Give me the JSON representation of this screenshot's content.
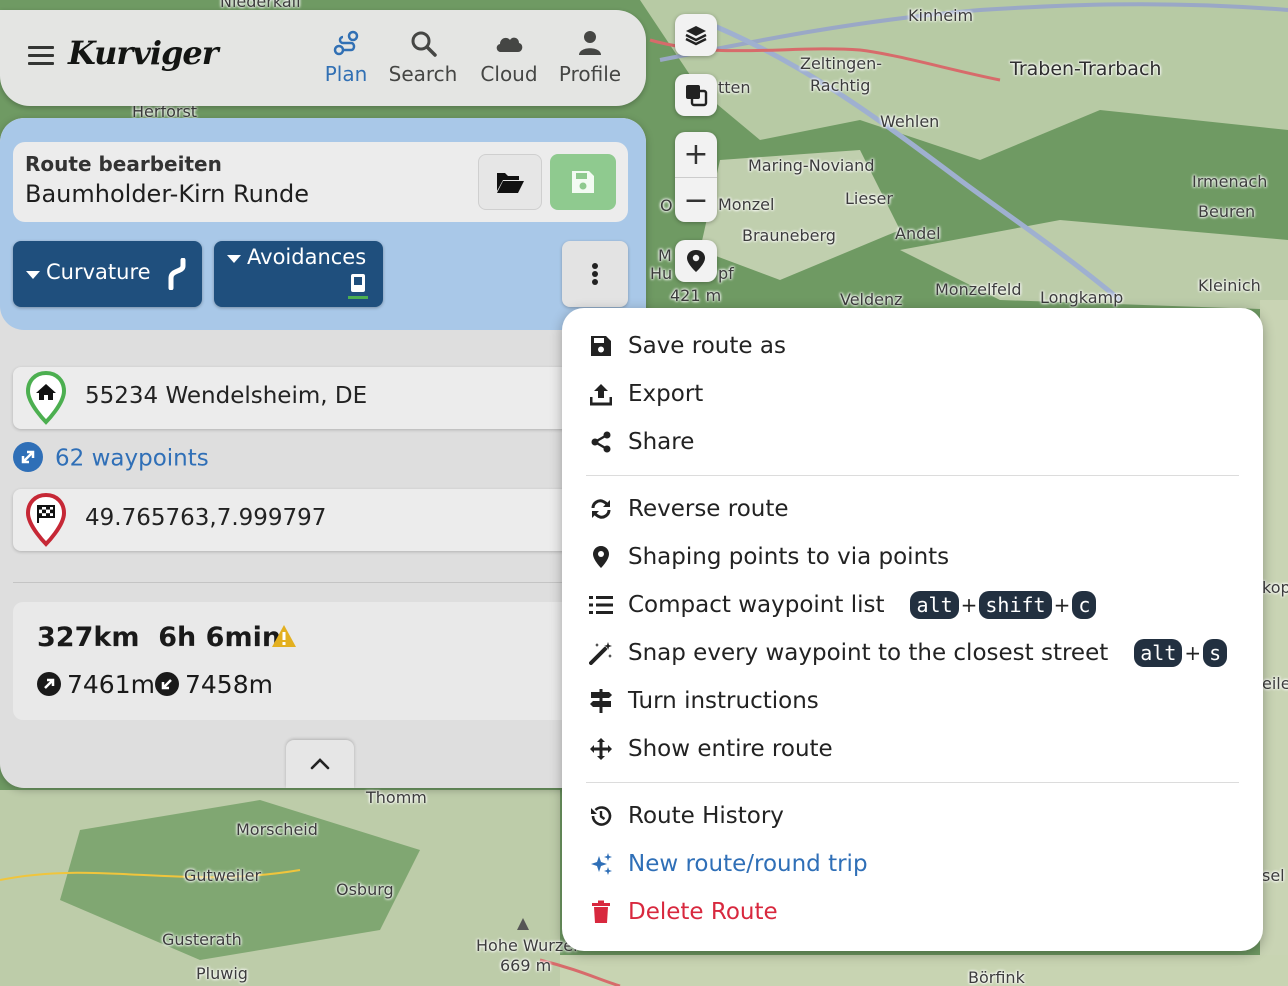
{
  "app": {
    "logo_text": "Kurviger"
  },
  "nav": {
    "items": [
      {
        "label": "Plan",
        "icon": "plan-route-icon",
        "active": true
      },
      {
        "label": "Search",
        "icon": "search-icon"
      },
      {
        "label": "Cloud",
        "icon": "cloud-icon"
      },
      {
        "label": "Profile",
        "icon": "user-icon"
      }
    ]
  },
  "map": {
    "labels": [
      "Niederkail",
      "Kinheim",
      "Zeltingen-",
      "Rachtig",
      "Traben-Trarbach",
      "Wehlen",
      "Maring-Noviand",
      "Lieser",
      "Monzel",
      "Irmenach",
      "Beuren",
      "Brauneberg",
      "Andel",
      "Kleinich",
      "Monzelfeld",
      "Longkamp",
      "Veldenz",
      "421 m",
      "Herforst",
      "Thomm",
      "Morscheid",
      "Gutweiler",
      "Osburg",
      "Gusterath",
      "Pluwig",
      "Hohe Wurzel",
      "669 m",
      "Börfink",
      "tten",
      "Hu",
      "pf",
      "M",
      "kop",
      "eile",
      "sel",
      "O"
    ]
  },
  "controls": {
    "layers": "layers-icon",
    "overlay": "overlay-icon",
    "zoom_in": "+",
    "zoom_out": "−",
    "locate": "map-marker-icon"
  },
  "panel": {
    "title": "Route bearbeiten",
    "route_name": "Baumholder-Kirn Runde",
    "curvature_label": "Curvature",
    "avoidances_label": "Avoidances",
    "start": "55234 Wendelsheim, DE",
    "waypoints_link": "62 waypoints",
    "destination": "49.765763,7.999797",
    "distance": "327km",
    "duration": "6h 6min",
    "ascent": "7461m",
    "descent": "7458m"
  },
  "menu": {
    "items": [
      {
        "label": "Save route as",
        "icon": "floppy-disk-icon"
      },
      {
        "label": "Export",
        "icon": "upload-icon"
      },
      {
        "label": "Share",
        "icon": "share-icon"
      },
      {
        "label": "Reverse route",
        "icon": "sync-icon"
      },
      {
        "label": "Shaping points to via points",
        "icon": "location-pin-icon"
      },
      {
        "label": "Compact waypoint list",
        "icon": "list-icon",
        "shortcut": [
          "alt",
          "shift",
          "c"
        ]
      },
      {
        "label": "Snap every waypoint to the closest street",
        "icon": "magic-wand-icon",
        "shortcut": [
          "alt",
          "s"
        ]
      },
      {
        "label": "Turn instructions",
        "icon": "signpost-icon"
      },
      {
        "label": "Show entire route",
        "icon": "move-arrows-icon"
      },
      {
        "label": "Route History",
        "icon": "history-icon"
      },
      {
        "label": "New route/round trip",
        "icon": "sparkles-icon",
        "color": "#2f6fb7"
      },
      {
        "label": "Delete Route",
        "icon": "trash-icon",
        "color": "#d8283e"
      }
    ],
    "plus": "+"
  },
  "colors": {
    "accent": "#2f6fb7",
    "pill_bg": "#1f4f7d",
    "save_green": "#8fca8f",
    "danger": "#d8283e",
    "panel_head": "#a9c8e8"
  }
}
